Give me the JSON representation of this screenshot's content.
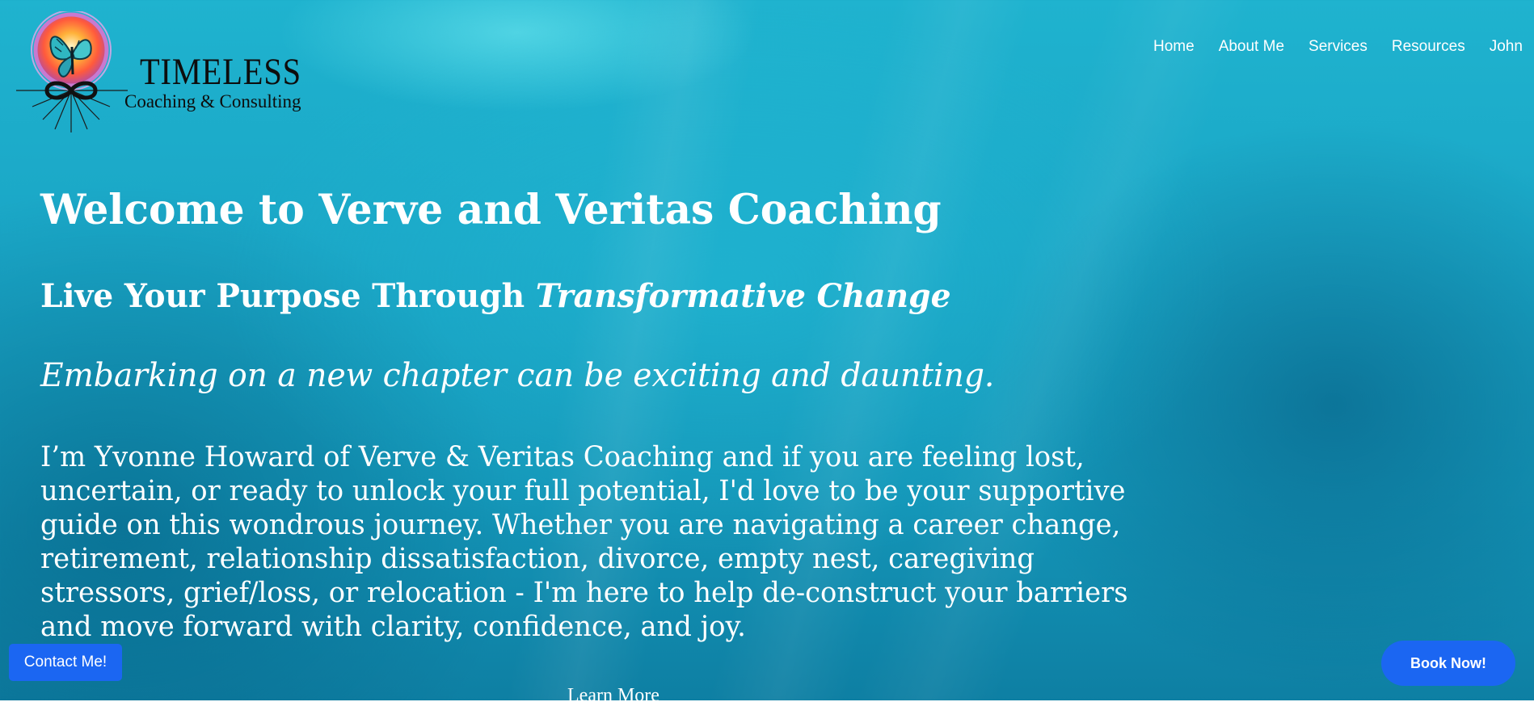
{
  "logo": {
    "title": "TIMELESS",
    "subtitle": "Coaching & Consulting",
    "icon": "butterfly-circle-logo-icon"
  },
  "nav": {
    "items": [
      {
        "label": "Home"
      },
      {
        "label": "About Me"
      },
      {
        "label": "Services"
      },
      {
        "label": "Resources"
      },
      {
        "label": "John"
      }
    ]
  },
  "hero": {
    "title": "Welcome to Verve and Veritas Coaching",
    "subtitle_plain": "Live Your Purpose Through ",
    "subtitle_italic": "Transformative Change",
    "lead": "Embarking on a new chapter can be exciting and daunting.",
    "body_lines": [
      "I’m Yvonne Howard of Verve & Veritas Coaching and if you are feeling lost,",
      "uncertain, or ready to unlock your full potential, I'd love to be your supportive",
      "guide on this wondrous journey. Whether you are navigating a career change,",
      "retirement, relationship dissatisfaction, divorce, empty nest, caregiving",
      "stressors, grief/loss, or relocation - I'm here to help de-construct your barriers",
      "and move forward with clarity, confidence, and joy."
    ],
    "learn_more": "Learn More"
  },
  "buttons": {
    "contact": "Contact Me!",
    "book": "Book Now!"
  },
  "colors": {
    "accent": "#1b66f2",
    "text": "#ffffff",
    "background": "#1aa6c6"
  }
}
